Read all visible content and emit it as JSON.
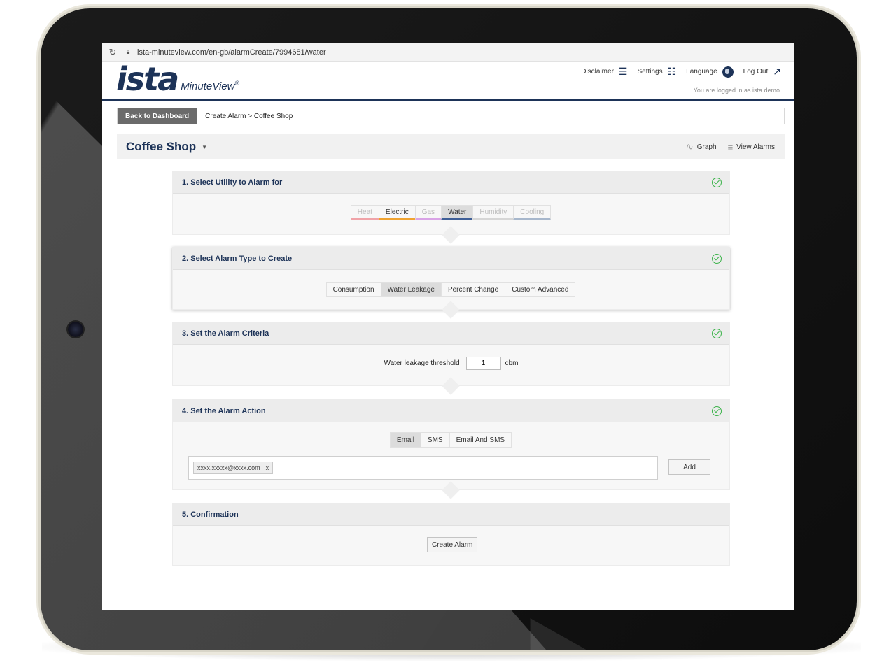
{
  "browser": {
    "url": "ista-minuteview.com/en-gb/alarmCreate/7994681/water"
  },
  "header": {
    "logo_main": "ista",
    "logo_sub": "MinuteView",
    "logo_mark": "®",
    "nav": [
      {
        "label": "Disclaimer",
        "icon": "list-icon"
      },
      {
        "label": "Settings",
        "icon": "sliders-icon"
      },
      {
        "label": "Language",
        "icon": "globe-icon"
      },
      {
        "label": "Log Out",
        "icon": "external-link-icon"
      }
    ],
    "logged_in_text": "You are logged in as ista.demo"
  },
  "breadcrumb": {
    "back_label": "Back to Dashboard",
    "path": "Create Alarm > Coffee Shop"
  },
  "title_bar": {
    "title": "Coffee Shop",
    "actions": [
      {
        "label": "Graph",
        "icon": "graph-icon"
      },
      {
        "label": "View Alarms",
        "icon": "list-lines-icon"
      }
    ]
  },
  "steps": {
    "utility": {
      "title": "1. Select Utility to Alarm for",
      "options": [
        {
          "label": "Heat",
          "color": "#f0a3a8",
          "muted": true
        },
        {
          "label": "Electric",
          "color": "#f0a330",
          "muted": false
        },
        {
          "label": "Gas",
          "color": "#d9a3e6",
          "muted": true
        },
        {
          "label": "Water",
          "color": "#3f5f97",
          "muted": false,
          "selected": true
        },
        {
          "label": "Humidity",
          "color": "#d6d6d6",
          "muted": true
        },
        {
          "label": "Cooling",
          "color": "#a7b7cc",
          "muted": true
        }
      ]
    },
    "alarm_type": {
      "title": "2. Select Alarm Type to Create",
      "options": [
        {
          "label": "Consumption"
        },
        {
          "label": "Water Leakage",
          "selected": true
        },
        {
          "label": "Percent Change"
        },
        {
          "label": "Custom Advanced"
        }
      ]
    },
    "criteria": {
      "title": "3. Set the Alarm Criteria",
      "label": "Water leakage threshold",
      "value": "1",
      "unit": "cbm"
    },
    "action": {
      "title": "4. Set the Alarm Action",
      "options": [
        {
          "label": "Email",
          "selected": true
        },
        {
          "label": "SMS"
        },
        {
          "label": "Email And SMS"
        }
      ],
      "email_tag": "xxxx.xxxxx@xxxx.com",
      "email_tag_remove": "x",
      "add_label": "Add"
    },
    "confirmation": {
      "title": "5. Confirmation",
      "create_label": "Create Alarm"
    }
  },
  "colors": {
    "brand_navy": "#1d3358",
    "brand_green": "#2a9d5c",
    "check_green": "#3bb34a"
  }
}
